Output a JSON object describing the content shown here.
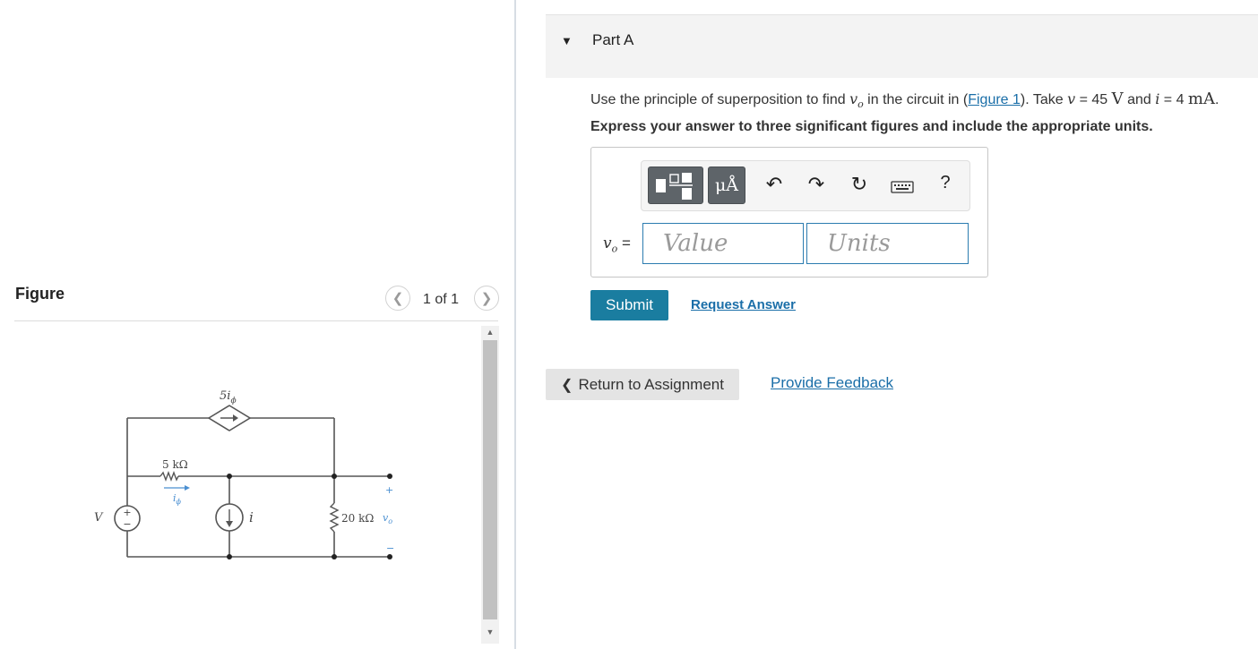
{
  "figure_panel": {
    "title": "Figure",
    "counter": "1 of 1",
    "prev_icon": "chevron-left-icon",
    "next_icon": "chevron-right-icon",
    "circuit": {
      "dep_source_label": "5i",
      "dep_source_sub": "ϕ",
      "resistor1_label": "5 kΩ",
      "current_label": "i",
      "current_sub": "ϕ",
      "voltage_source_label": "V",
      "current_source_label": "i",
      "resistor2_label": "20 kΩ",
      "output_label": "v",
      "output_sub": "o",
      "plus": "+",
      "minus": "−"
    }
  },
  "part": {
    "title": "Part A",
    "question_pre": "Use the principle of superposition to find ",
    "vo_var": "v",
    "vo_sub": "o",
    "question_mid": " in the circuit in (",
    "figure_link": "Figure 1",
    "question_take": "). Take ",
    "v_var": "v",
    "v_eq": " = 45 ",
    "v_unit": "V",
    "and_text": " and ",
    "i_var": "i",
    "i_eq": " = 4 ",
    "i_unit": "mA",
    "period": ".",
    "instruction": "Express your answer to three significant figures and include the appropriate units."
  },
  "answer": {
    "units_button": "μÅ",
    "help": "?",
    "label_var": "v",
    "label_sub": "o",
    "label_eq": " =",
    "value_placeholder": "Value",
    "units_placeholder": "Units"
  },
  "actions": {
    "submit": "Submit",
    "request_answer": "Request Answer",
    "return": "Return to Assignment",
    "feedback": "Provide Feedback"
  },
  "colors": {
    "accent": "#1a7da0",
    "link": "#1a6ea8",
    "circuit_blue": "#4a8fd1"
  }
}
